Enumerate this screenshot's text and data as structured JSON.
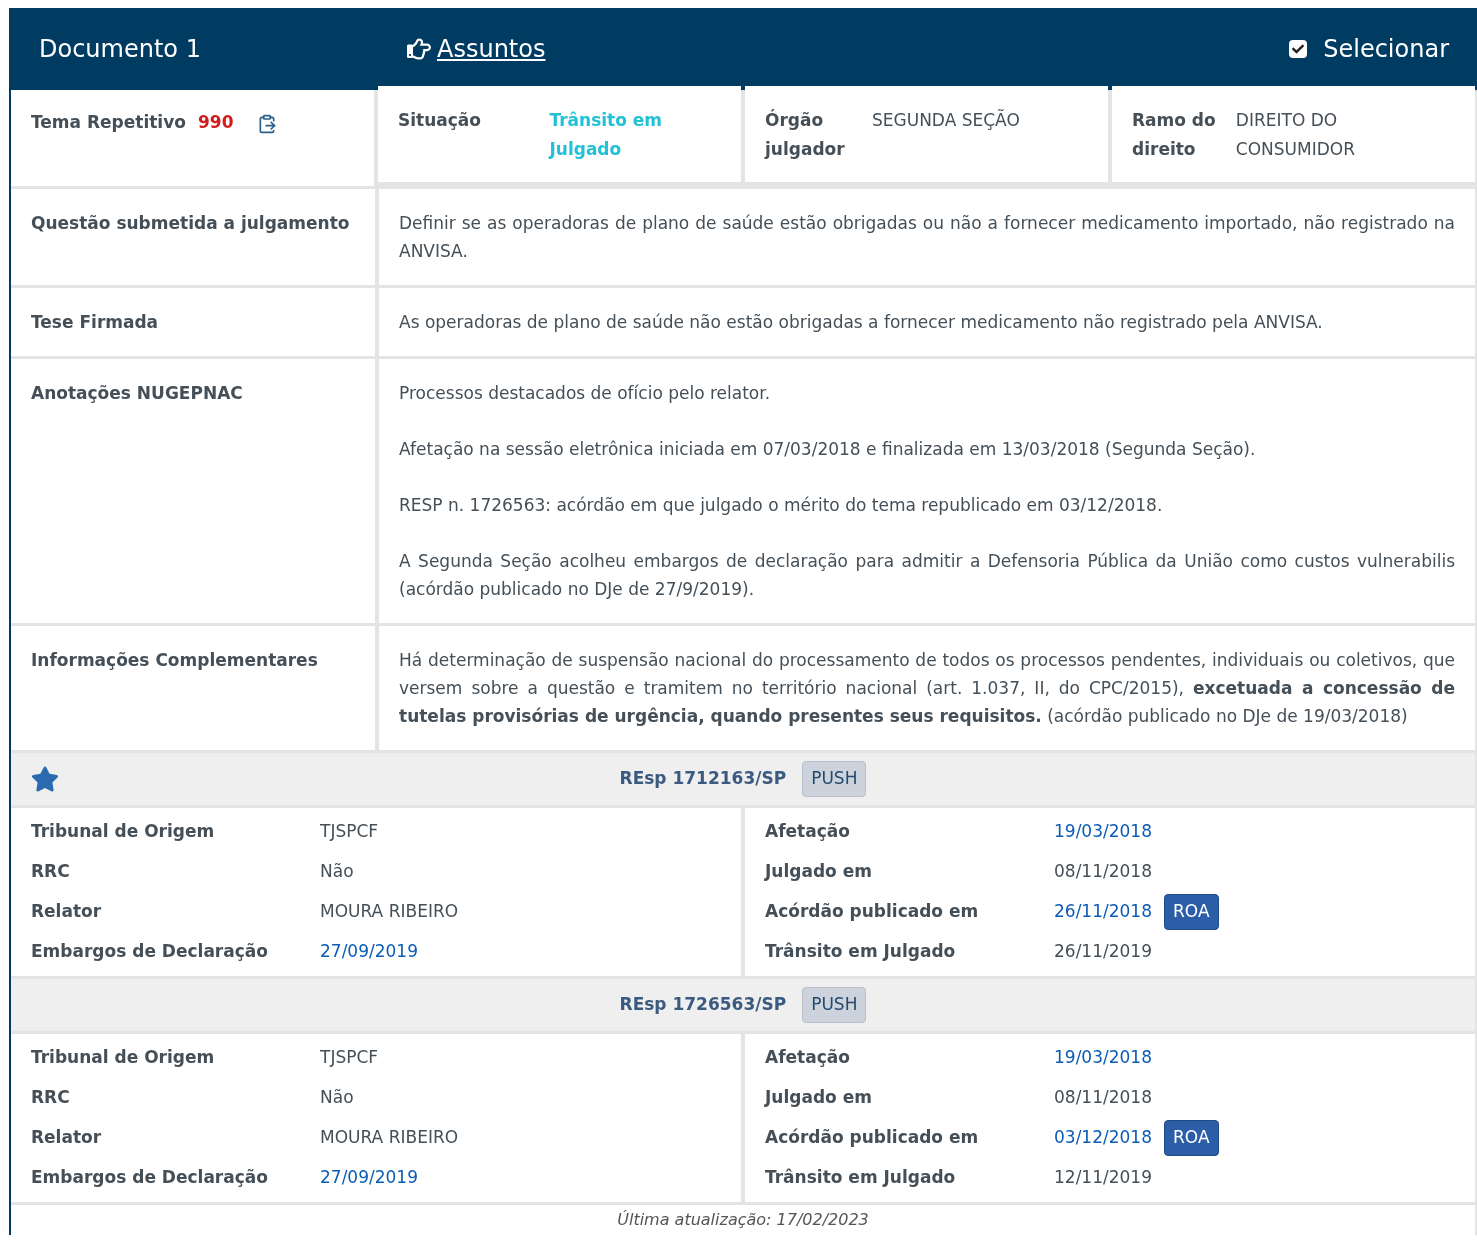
{
  "header": {
    "title": "Documento 1",
    "subjects_link": "Assuntos",
    "select": {
      "label": "Selecionar",
      "checked": true
    }
  },
  "summary": {
    "theme": {
      "label": "Tema Repetitivo",
      "number": "990"
    },
    "situation": {
      "label": "Situação",
      "value": "Trânsito em Julgado"
    },
    "organ": {
      "label": "Órgão julgador",
      "value": "SEGUNDA SEÇÃO"
    },
    "branch": {
      "label": "Ramo do direito",
      "value": "DIREITO DO CONSUMIDOR"
    }
  },
  "sections": [
    {
      "label": "Questão submetida a julgamento",
      "paragraphs": [
        "Definir se as operadoras de plano de saúde estão obrigadas ou não a fornecer medicamento importado, não registrado na ANVISA."
      ]
    },
    {
      "label": "Tese Firmada",
      "paragraphs": [
        "As operadoras de plano de saúde não estão obrigadas a fornecer medicamento não registrado pela ANVISA."
      ]
    },
    {
      "label": "Anotações NUGEPNAC",
      "paragraphs": [
        "Processos destacados de ofício pelo relator.",
        "Afetação na sessão eletrônica iniciada em 07/03/2018 e finalizada em 13/03/2018 (Segunda Seção).",
        "RESP n. 1726563: acórdão em que julgado o mérito do tema republicado em 03/12/2018.",
        "A Segunda Seção acolheu embargos de declaração para admitir a Defensoria Pública da União como custos vulnerabilis (acórdão publicado no DJe de 27/9/2019)."
      ]
    },
    {
      "label": "Informações Complementares",
      "paragraphs": [
        "Há determinação de suspensão nacional do processamento de todos os processos pendentes, individuais ou coletivos, que versem sobre a questão e tramitem no território nacional (art. 1.037, II, do CPC/2015), **excetuada a concessão de tutelas provisórias de urgência, quando presentes seus requisitos.** (acórdão publicado no DJe de 19/03/2018)"
      ]
    }
  ],
  "processes": [
    {
      "starred": true,
      "title": "REsp 1712163/SP",
      "push": "PUSH",
      "left": [
        {
          "label": "Tribunal de Origem",
          "value": "TJSPCF",
          "link": false
        },
        {
          "label": "RRC",
          "value": "Não",
          "link": false
        },
        {
          "label": "Relator",
          "value": "MOURA RIBEIRO",
          "link": false
        },
        {
          "label": "Embargos de Declaração",
          "value": "27/09/2019",
          "link": true
        }
      ],
      "right": [
        {
          "label": "Afetação",
          "value": "19/03/2018",
          "link": true
        },
        {
          "label": "Julgado em",
          "value": "08/11/2018",
          "link": false
        },
        {
          "label": "Acórdão publicado em",
          "value": "26/11/2018",
          "link": true,
          "button": "ROA"
        },
        {
          "label": "Trânsito em Julgado",
          "value": "26/11/2019",
          "link": false
        }
      ]
    },
    {
      "starred": false,
      "title": "REsp 1726563/SP",
      "push": "PUSH",
      "left": [
        {
          "label": "Tribunal de Origem",
          "value": "TJSPCF",
          "link": false
        },
        {
          "label": "RRC",
          "value": "Não",
          "link": false
        },
        {
          "label": "Relator",
          "value": "MOURA RIBEIRO",
          "link": false
        },
        {
          "label": "Embargos de Declaração",
          "value": "27/09/2019",
          "link": true
        }
      ],
      "right": [
        {
          "label": "Afetação",
          "value": "19/03/2018",
          "link": true
        },
        {
          "label": "Julgado em",
          "value": "08/11/2018",
          "link": false
        },
        {
          "label": "Acórdão publicado em",
          "value": "03/12/2018",
          "link": true,
          "button": "ROA"
        },
        {
          "label": "Trânsito em Julgado",
          "value": "12/11/2019",
          "link": false
        }
      ]
    }
  ],
  "footer": "Última atualização: 17/02/2023"
}
